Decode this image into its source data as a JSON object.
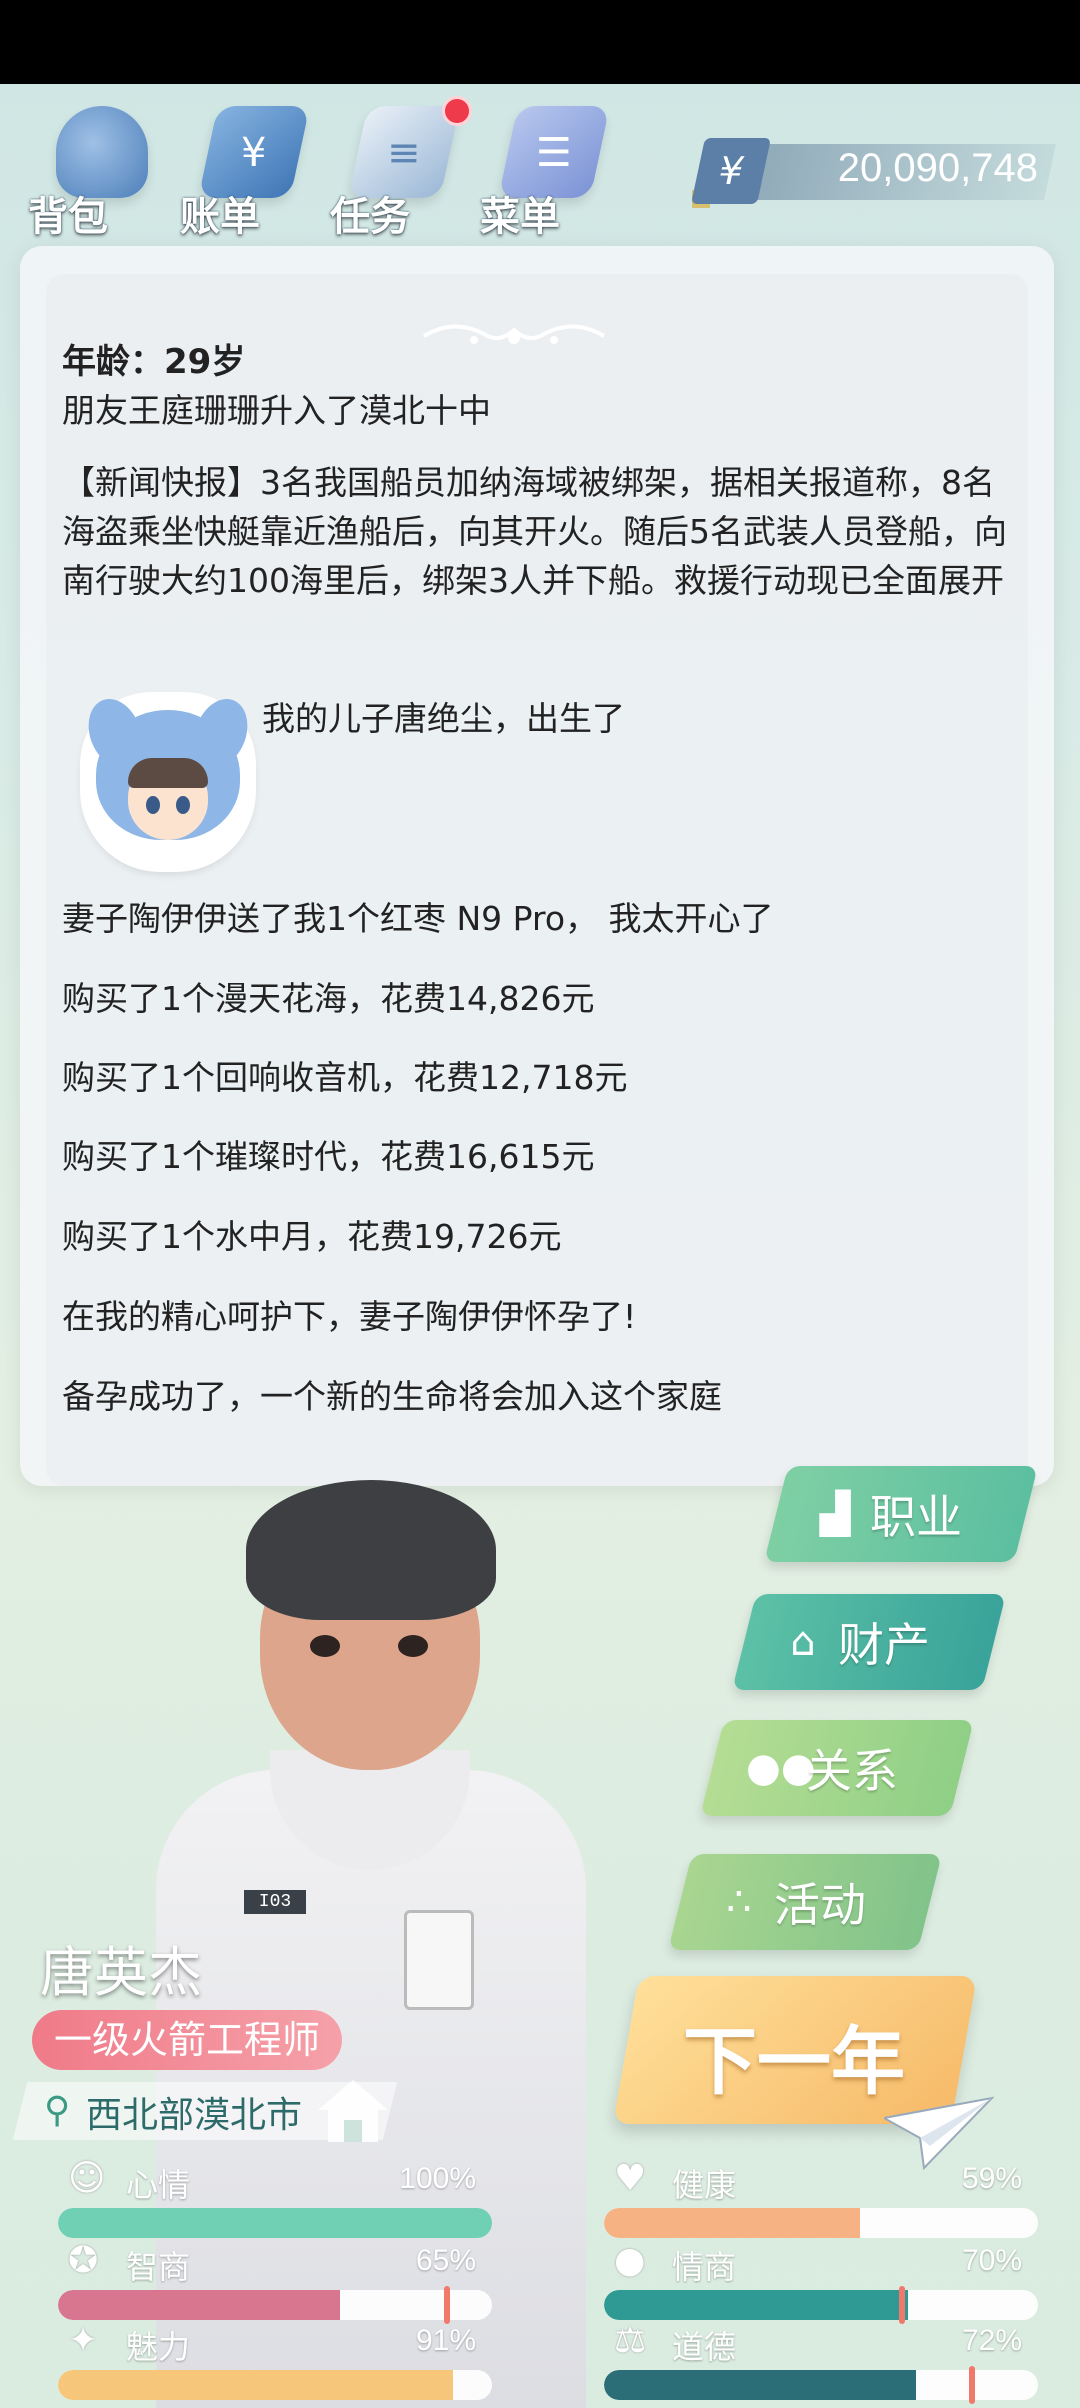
{
  "toolbar": {
    "items": [
      {
        "label": "背包",
        "icon": "bag-icon"
      },
      {
        "label": "账单",
        "icon": "bill-icon"
      },
      {
        "label": "任务",
        "icon": "task-icon",
        "has_badge": true
      },
      {
        "label": "菜单",
        "icon": "menu-icon"
      }
    ],
    "currency_symbol": "¥",
    "money": "20,090,748"
  },
  "feed": {
    "age": "年龄：29岁",
    "events": [
      "朋友王庭珊珊升入了漠北十中",
      "【新闻快报】3名我国船员加纳海域被绑架，据相关报道称，8名海盗乘坐快艇靠近渔船后，向其开火。随后5名武装人员登船，向南行驶大约100海里后，绑架3人并下船。救援行动现已全面展开",
      "我的儿子唐绝尘，出生了",
      "妻子陶伊伊送了我1个红枣 N9 Pro， 我太开心了",
      "购买了1个漫天花海，花费14,826元",
      "购买了1个回响收音机，花费12,718元",
      "购买了1个璀璨时代，花费16,615元",
      "购买了1个水中月，花费19,726元",
      "在我的精心呵护下，妻子陶伊伊怀孕了!",
      "备孕成功了，一个新的生命将会加入这个家庭"
    ]
  },
  "side_menu": {
    "career": "职业",
    "property": "财产",
    "relation": "关系",
    "activity": "活动"
  },
  "next_year": "下一年",
  "player": {
    "name": "唐英杰",
    "job": "一级火箭工程师",
    "location": "西北部漠北市",
    "badge_code": "I03"
  },
  "stats": [
    {
      "label": "心情",
      "value": "100%",
      "fraction": 1.0,
      "color": "#6fd0b4",
      "icon": "smile-icon"
    },
    {
      "label": "健康",
      "value": "59%",
      "fraction": 0.59,
      "color": "#f7b283",
      "icon": "heart-icon"
    },
    {
      "label": "智商",
      "value": "65%",
      "fraction": 0.65,
      "color": "#d9768f",
      "icon": "bulb-icon",
      "marker": 0.89
    },
    {
      "label": "情商",
      "value": "70%",
      "fraction": 0.7,
      "color": "#2f9a94",
      "icon": "apple-icon",
      "marker": 0.68
    },
    {
      "label": "魅力",
      "value": "91%",
      "fraction": 0.91,
      "color": "#f6c67a",
      "icon": "sparkle-icon"
    },
    {
      "label": "道德",
      "value": "72%",
      "fraction": 0.72,
      "color": "#2c6e78",
      "icon": "scale-icon",
      "marker": 0.84
    }
  ]
}
